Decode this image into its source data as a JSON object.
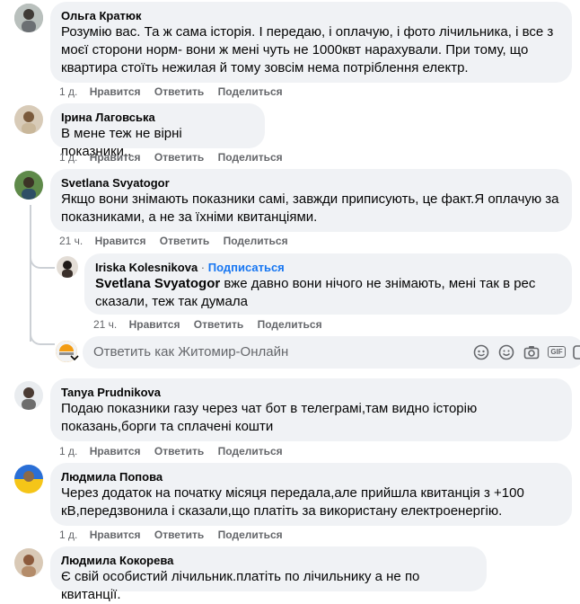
{
  "comments": [
    {
      "author": "Ольга Кратюк",
      "text": "Розумію вас. Та ж сама історія. І передаю, і оплачую, і фото лічильника, і все з моєї сторони норм- вони ж мені чуть не 1000квт нарахували. При тому, що квартира стоїть нежилая й тому зовсім нема потріблення електр.",
      "time": "1 д.",
      "like": "Нравится",
      "reply": "Ответить",
      "share": "Поделиться"
    },
    {
      "author": "Ірина Лаговська",
      "text": "В мене теж не вірні показники..",
      "time": "1 д.",
      "like": "Нравится",
      "reply": "Ответить",
      "share": "Поделиться"
    },
    {
      "author": "Svetlana Svyatogor",
      "text": "Якщо вони знімають показники самі, завжди приписують, це факт.Я оплачую за показниками, а не за їхніми квитанціями.",
      "time": "21 ч.",
      "like": "Нравится",
      "reply": "Ответить",
      "share": "Поделиться"
    }
  ],
  "reply": {
    "author": "Iriska Kolesnikova",
    "separator": "·",
    "follow": "Подписаться",
    "mention": "Svetlana Svyatogor",
    "text": " вже давно вони нічого не знімають, мені так в рес сказали, теж так думала",
    "time": "21 ч.",
    "like": "Нравится",
    "reply": "Ответить",
    "share": "Поделиться"
  },
  "reply_box": {
    "placeholder": "Ответить как Житомир-Онлайн",
    "icons": [
      "sticker-icon",
      "emoji-icon",
      "camera-icon",
      "gif-icon",
      "clip-icon"
    ],
    "gif_label": "GIF"
  },
  "comments2": [
    {
      "author": "Tanya Prudnikova",
      "text": "Подаю показники газу через чат бот в телеграмі,там видно історію показань,борги та сплачені кошти",
      "time": "1 д.",
      "like": "Нравится",
      "reply": "Ответить",
      "share": "Поделиться"
    },
    {
      "author": "Людмила Попова",
      "text": "Через додаток на початку місяця передала,але прийшла квитанція з +100 кВ,передзвонила і сказали,що платіть за використану електроенергію.",
      "time": "1 д.",
      "like": "Нравится",
      "reply": "Ответить",
      "share": "Поделиться"
    },
    {
      "author": "Людмила Кокорева",
      "text": "Є свій особистий лічильник.платіть по лічильнику а не по квитанції."
    }
  ],
  "colors": {
    "bubble": "#f0f2f5",
    "secondary_text": "#65676b",
    "link": "#1877f2"
  }
}
